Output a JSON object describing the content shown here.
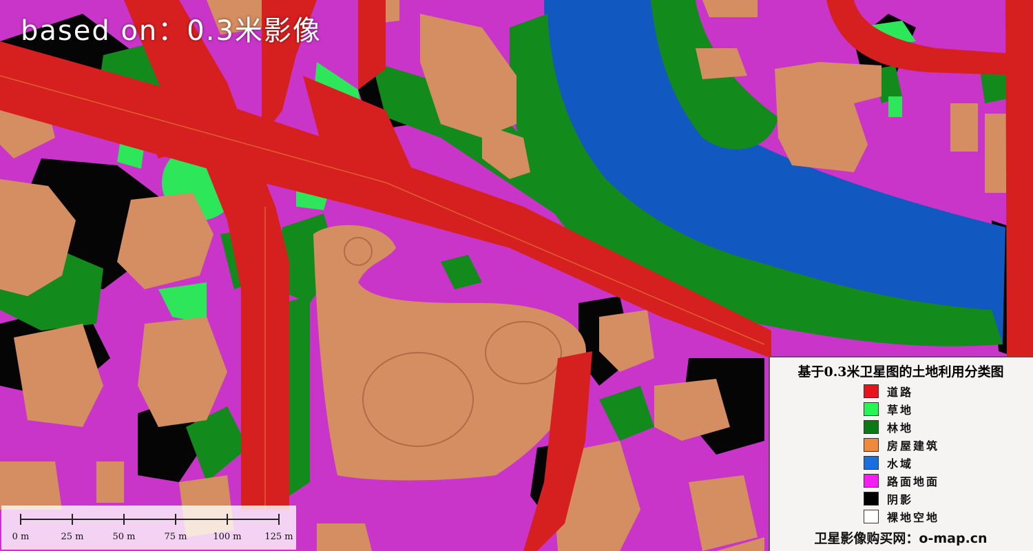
{
  "overlay_title": "based on：0.3米影像",
  "legend": {
    "title": "基于0.3米卫星图的土地利用分类图",
    "items": [
      {
        "label": "道路",
        "color": "#e8141b"
      },
      {
        "label": "草地",
        "color": "#26f554"
      },
      {
        "label": "林地",
        "color": "#0c7a14"
      },
      {
        "label": "房屋建筑",
        "color": "#f08a3a"
      },
      {
        "label": "水域",
        "color": "#1a6fe0"
      },
      {
        "label": "路面地面",
        "color": "#f21ef2"
      },
      {
        "label": "阴影",
        "color": "#000000"
      },
      {
        "label": "裸地空地",
        "color": "#ffffff"
      }
    ],
    "footer": "卫星影像购买网：o-map.cn"
  },
  "scale_bar": {
    "ticks": [
      "0 m",
      "25 m",
      "50 m",
      "75 m",
      "100 m",
      "125 m"
    ]
  }
}
